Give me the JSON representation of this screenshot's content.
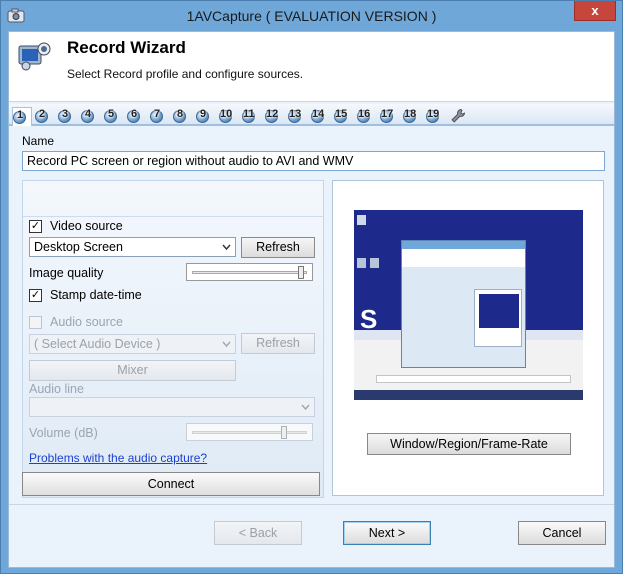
{
  "window": {
    "title": "1AVCapture ( EVALUATION VERSION )",
    "close_glyph": "x",
    "app_icon": "camera-app-icon"
  },
  "header": {
    "title": "Record Wizard",
    "subtitle": "Select Record profile and configure sources.",
    "icon": "record-wizard-icon"
  },
  "steps": {
    "items": [
      "1",
      "2",
      "3",
      "4",
      "5",
      "6",
      "7",
      "8",
      "9",
      "10",
      "11",
      "12",
      "13",
      "14",
      "15",
      "16",
      "17",
      "18",
      "19"
    ],
    "active": "1",
    "tools_icon": "wrench-icon"
  },
  "name": {
    "label": "Name",
    "value": "Record PC screen or region without audio to AVI and WMV"
  },
  "video": {
    "checkbox_label": "Video source",
    "checked": true,
    "device": "Desktop Screen",
    "refresh_label": "Refresh",
    "quality_label": "Image quality",
    "quality_level": 0.95,
    "stamp_label": "Stamp date-time",
    "stamp_checked": true
  },
  "audio": {
    "checkbox_label": "Audio source",
    "checked": false,
    "device": "( Select Audio Device )",
    "refresh_label": "Refresh",
    "mixer_label": "Mixer",
    "line_label": "Audio line",
    "line_value": "",
    "volume_label": "Volume (dB)",
    "volume_level": 0.8,
    "problems_link": "Problems with the audio capture?"
  },
  "connect_label": "Connect",
  "preview": {
    "button_label": "Window/Region/Frame-Rate"
  },
  "nav": {
    "back_label": "< Back",
    "next_label": "Next >",
    "cancel_label": "Cancel"
  },
  "check_glyph": "✓"
}
